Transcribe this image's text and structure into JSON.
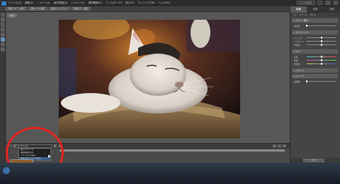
{
  "menubar": {
    "items": [
      "ファイル(F)",
      "編集(E)",
      "イメージ(I)",
      "画質調整(N)",
      "レイヤー(L)",
      "選択範囲(S)",
      "フィルター(T)",
      "表示(V)",
      "ウィンドウ(W)",
      "ヘルプ(H)"
    ],
    "search_placeholder": "ヘルプを検索",
    "minimize": "–",
    "maximize": "□",
    "close": "×"
  },
  "toolbar": {
    "chips": [
      "自動スマート補正",
      "自動レベル補正",
      "自動コントラスト",
      "自動カラー補正"
    ]
  },
  "document": {
    "tab_label": "写真1"
  },
  "bin": {
    "label": "表示:",
    "selected": "開いたファイル",
    "options": [
      "開いたファイル",
      "選択範囲を表示",
      "アルバムから表示",
      "整理済みファイルを表示"
    ]
  },
  "panels": {
    "tabs": [
      "編集",
      "作成",
      "共有"
    ],
    "subtabs": [
      "フル",
      "クイック",
      "ガイド"
    ],
    "sections": [
      {
        "title": "スマート補正",
        "sliders": [
          {
            "label": "補正量",
            "value": 0.0
          }
        ]
      },
      {
        "title": "ライティング",
        "sliders": [
          {
            "label": "シャドウ",
            "value": 0.5
          },
          {
            "label": "ハイライト",
            "value": 0.5
          },
          {
            "label": "中間調",
            "value": 0.5
          }
        ]
      },
      {
        "title": "カラー",
        "sliders": [
          {
            "label": "彩度",
            "value": 0.5
          },
          {
            "label": "色相",
            "value": 0.5
          },
          {
            "label": "色温度",
            "value": 0.5
          }
        ]
      },
      {
        "title": "バランス",
        "sliders": []
      },
      {
        "title": "シャープ",
        "sliders": [
          {
            "label": "適用量",
            "value": 0.0
          }
        ]
      }
    ],
    "footer_button": "リセット"
  },
  "colors": {
    "annotation": "#e8231f",
    "accent": "#3a5f8a"
  }
}
